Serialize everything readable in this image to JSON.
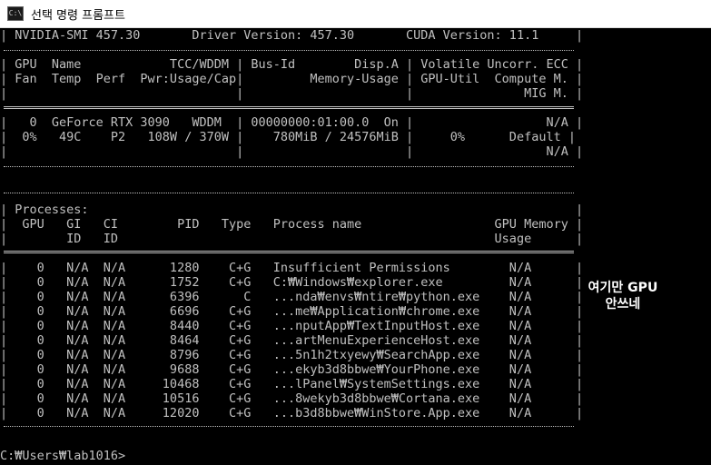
{
  "window": {
    "title": "선택 명령 프롬프트",
    "icon": "cmd-icon"
  },
  "header": {
    "line1": "| NVIDIA-SMI 457.30       Driver Version: 457.30       CUDA Version: 11.1     |",
    "col_header": [
      "| GPU  Name            TCC/WDDM | Bus-Id        Disp.A | Volatile Uncorr. ECC |",
      "| Fan  Temp  Perf  Pwr:Usage/Cap|         Memory-Usage | GPU-Util  Compute M. |",
      "|                               |                      |               MIG M. |"
    ],
    "gpu_rows": [
      "|   0  GeForce RTX 3090   WDDM  | 00000000:01:00.0  On |                  N/A |",
      "|  0%   49C    P2   108W / 370W |    780MiB / 24576MiB |     0%      Default |",
      "|                               |                      |                  N/A |"
    ]
  },
  "processes": {
    "title": "| Processes:                                                                  |",
    "header": [
      "|  GPU   GI   CI        PID   Type   Process name                  GPU Memory |",
      "|        ID   ID                                                   Usage      |"
    ],
    "rows": [
      "|    0   N/A  N/A      1280    C+G   Insufficient Permissions        N/A      |",
      "|    0   N/A  N/A      1752    C+G   C:₩Windows₩explorer.exe         N/A      |",
      "|    0   N/A  N/A      6396      C   ...nda₩envs₩ntire₩python.exe    N/A      |",
      "|    0   N/A  N/A      6696    C+G   ...me₩Application₩chrome.exe    N/A      |",
      "|    0   N/A  N/A      8440    C+G   ...nputApp₩TextInputHost.exe    N/A      |",
      "|    0   N/A  N/A      8464    C+G   ...artMenuExperienceHost.exe    N/A      |",
      "|    0   N/A  N/A      8796    C+G   ...5n1h2txyewy₩SearchApp.exe    N/A      |",
      "|    0   N/A  N/A      9688    C+G   ...ekyb3d8bbwe₩YourPhone.exe    N/A      |",
      "|    0   N/A  N/A     10468    C+G   ...lPanel₩SystemSettings.exe    N/A      |",
      "|    0   N/A  N/A     10516    C+G   ...8wekyb3d8bbwe₩Cortana.exe    N/A      |",
      "|    0   N/A  N/A     12020    C+G   ...b3d8bbwe₩WinStore.App.exe    N/A      |"
    ]
  },
  "annotation": {
    "line1": "여기만 GPU",
    "line2": "안쓰네"
  },
  "prompt": "C:₩Users₩lab1016>"
}
